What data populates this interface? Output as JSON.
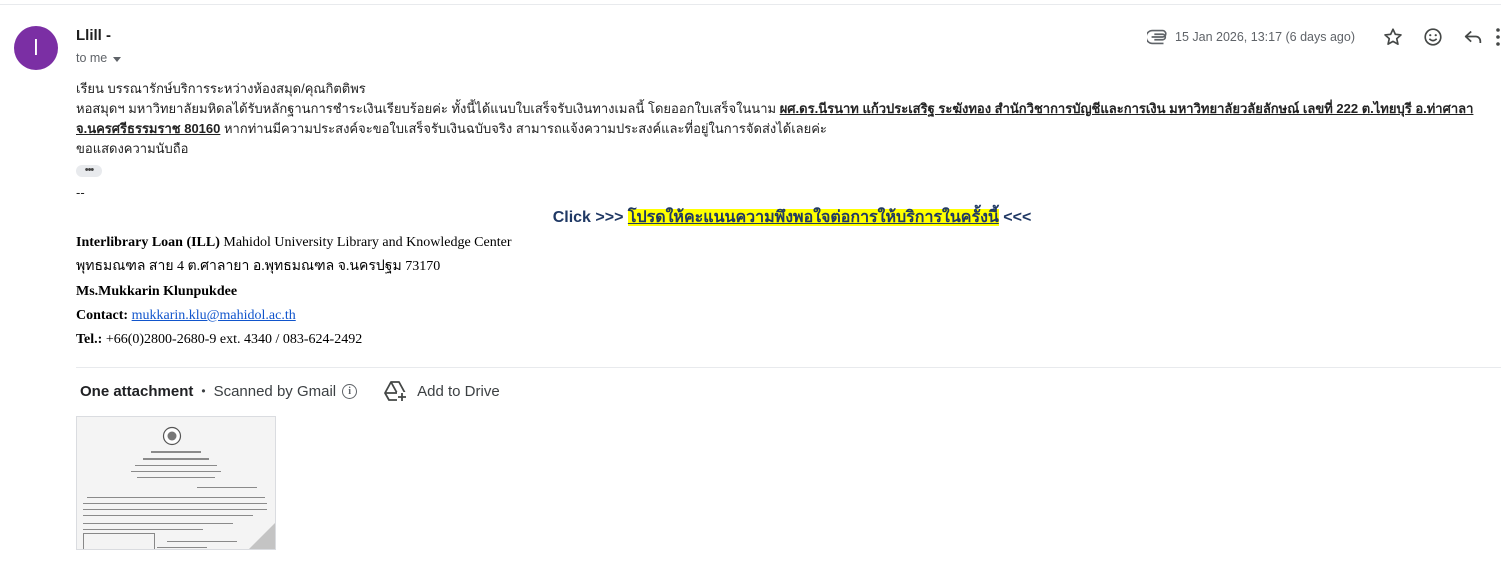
{
  "sender": {
    "initial": "l",
    "avatar_color": "#7b2fa4",
    "name": "Llill -",
    "recipient": "to me"
  },
  "meta": {
    "date": "15 Jan 2026, 13:17 (6 days ago)",
    "icons": [
      "attachment-icon",
      "star-icon",
      "emoji-icon",
      "reply-icon",
      "more-vert-icon"
    ]
  },
  "body": {
    "greeting": "เรียน บรรณารักษ์บริการระหว่างห้องสมุด/คุณกิตติพร",
    "line2_text": "หอสมุดฯ มหาวิทยาลัยมหิดลได้รับหลักฐานการชำระเงินเรียบร้อยค่ะ ทั้งนี้ได้แนบใบเสร็จรับเงินทางเมลนี้ โดยออกใบเสร็จในนาม ",
    "line2_bold_underline": "ผศ.ดร.นีรนาท แก้วประเสริฐ ระฆังทอง สำนักวิชาการบัญชีและการเงิน มหาวิทยาลัยวลัยลักษณ์ เลขที่ 222 ต.ไทยบุรี อ.ท่าศาลา จ.นครศรีธรรมราช 80160",
    "line2_tail": " หากท่านมีความประสงค์จะขอใบเสร็จรับเงินฉบับจริง สามารถแจ้งความประสงค์และที่อยู่ในการจัดส่งได้เลยค่ะ",
    "closing": "ขอแสดงความนับถือ",
    "ellipsis": "•••",
    "sig_dash": "--"
  },
  "cta": {
    "prefix": "Click >>> ",
    "link_text": "โปรดให้คะแนนความพึงพอใจต่อการให้บริการในครั้งนี้",
    "suffix": " <<<",
    "highlight_color": "#ffff00"
  },
  "signature": {
    "org_bold": "Interlibrary Loan (ILL)",
    "org_rest": " Mahidol University Library and Knowledge Center",
    "address": "พุทธมณฑล สาย 4  ต.ศาลายา อ.พุทธมณฑล จ.นครปฐม  73170",
    "person": "Ms.Mukkarin Klunpukdee",
    "contact_label": "Contact:",
    "contact_email": "mukkarin.klu@mahidol.ac.th",
    "tel_label": "Tel.:",
    "tel_value": " +66(0)2800-2680-9 ext. 4340 / 083-624-2492"
  },
  "attachments": {
    "title": "One attachment",
    "separator": "•",
    "scan_status": "Scanned by Gmail",
    "add_to_drive": "Add to Drive"
  }
}
